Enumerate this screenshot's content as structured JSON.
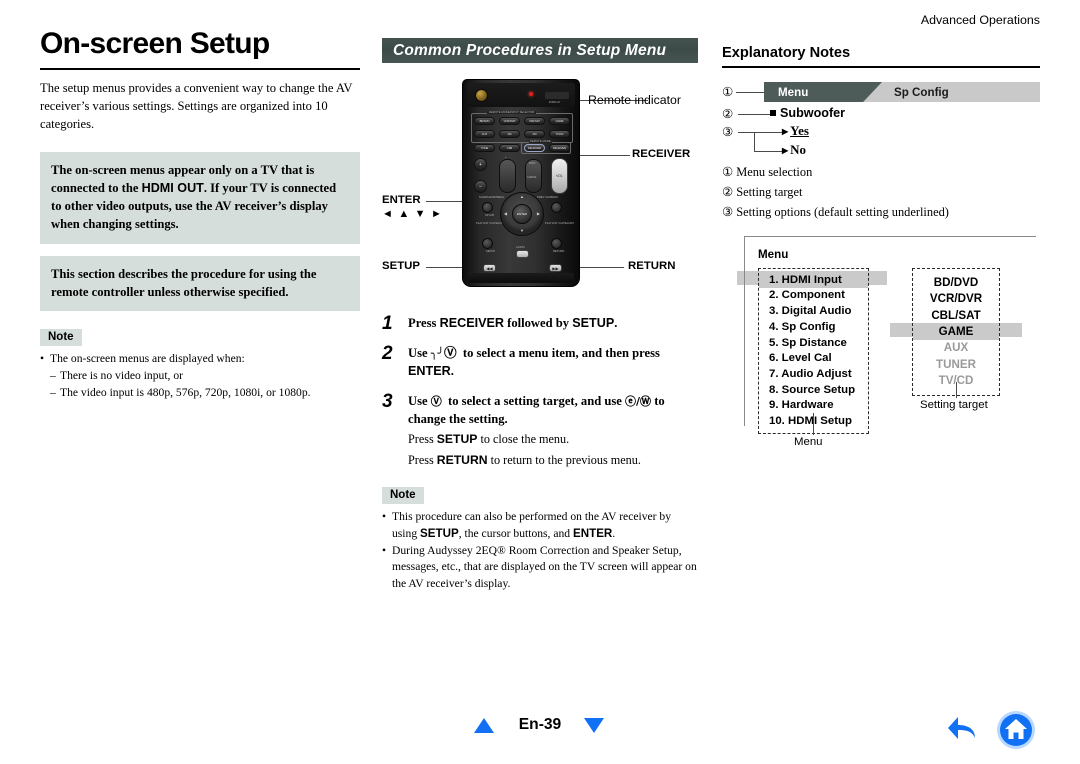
{
  "running_head": "Advanced Operations",
  "left": {
    "title": "On-screen Setup",
    "intro": "The setup menus provides a convenient way to change the AV receiver’s various settings. Settings are organized into 10 categories.",
    "callout_box_1": {
      "text_a": "The on-screen menus appear only on a TV that is connected to the ",
      "emph": "HDMI OUT",
      "text_b": ". If your TV is connected to other video outputs, use the AV receiver’s display when changing settings."
    },
    "callout_box_2": "This section describes the procedure for using the remote controller unless otherwise specified.",
    "note_label": "Note",
    "notes": [
      "The on-screen menus are displayed when:",
      "There is no video input, or",
      "The video input is 480p, 576p, 720p, 1080i, or 1080p."
    ]
  },
  "mid": {
    "section_title": "Common Procedures in Setup Menu",
    "remote": {
      "label_remote_indicator": "Remote indicator",
      "label_receiver": "RECEIVER",
      "label_enter": "ENTER",
      "label_arrows": "◄ ▲ ▼ ►",
      "label_setup": "SETUP",
      "label_return": "RETURN",
      "btn_display": "DISPLAY",
      "group_title": "REMOTE MODE/INPUT SELECTOR",
      "remote_mode_title": "REMOTE MODE",
      "selector_buttons": [
        "BD/DVD",
        "VCR/DVR",
        "CBL/SAT",
        "GAME",
        "AUX",
        "AM",
        "FM",
        "TV/CD",
        "TONE",
        "USB",
        "RECEIVER",
        "RECEIVER"
      ],
      "ch_label": "CH",
      "disc_label": "DISC",
      "album_label": "ALBUM",
      "vol_label": "VOL",
      "enter_label": "ENTER",
      "audio_label": "AUDIO",
      "setup_label": "SETUP",
      "return_label": "RETURN",
      "sp_ab_label": "SP A/B",
      "slideshow_label": "SLIDESHOW/MENU",
      "prev_ch_label": "PREV CH/MENU",
      "playlist_label": "PLAYLIST /CATEGORY",
      "free_ch_label": "FREE CH/MENU"
    },
    "steps": [
      {
        "num": "1",
        "parts": [
          {
            "t": "Press ",
            "s": false
          },
          {
            "t": "RECEIVER",
            "s": true
          },
          {
            "t": " followed by ",
            "s": false
          },
          {
            "t": "SETUP",
            "s": true
          },
          {
            "t": ".",
            "s": false
          }
        ]
      },
      {
        "num": "2",
        "parts": [
          {
            "t": "Use ",
            "s": false
          },
          {
            "t": "⑮",
            "s": false,
            "c": true
          },
          {
            "t": "  to select a menu item, and then press ",
            "s": false
          },
          {
            "t": "ENTER",
            "s": true
          },
          {
            "t": ".",
            "s": false
          }
        ]
      },
      {
        "num": "3",
        "parts": [
          {
            "t": "Use ",
            "s": false
          },
          {
            "t": "⑮",
            "s": false,
            "c": true
          },
          {
            "t": "  to select a setting target, and use ",
            "s": false
          },
          {
            "t": "⑤/⑯",
            "s": false,
            "c": true
          },
          {
            "t": " to change the setting.",
            "s": false
          }
        ],
        "subs": [
          [
            {
              "t": "Press ",
              "s": false
            },
            {
              "t": "SETUP",
              "s": true
            },
            {
              "t": " to close the menu.",
              "s": false
            }
          ],
          [
            {
              "t": "Press ",
              "s": false
            },
            {
              "t": "RETURN",
              "s": true
            },
            {
              "t": " to return to the previous menu.",
              "s": false
            }
          ]
        ]
      }
    ],
    "note_label": "Note",
    "notes": [
      [
        {
          "t": "This procedure can also be performed on the AV receiver by using ",
          "s": false
        },
        {
          "t": "SETUP",
          "s": true
        },
        {
          "t": ", the cursor buttons, and ",
          "s": false
        },
        {
          "t": "ENTER",
          "s": true
        },
        {
          "t": ".",
          "s": false
        }
      ],
      [
        {
          "t": "During Audyssey 2EQ® Room Correction and Speaker Setup, messages, etc., that are displayed on the TV screen will appear on the AV receiver’s display.",
          "s": false
        }
      ]
    ]
  },
  "right": {
    "title": "Explanatory Notes",
    "tab_active": "Menu",
    "tab_second": "Sp Config",
    "marker_1": "①",
    "marker_2": "②",
    "marker_3": "③",
    "tree_target": "Subwoofer",
    "tree_option_yes": "Yes",
    "tree_option_no": "No",
    "legend": [
      {
        "num": "①",
        "text": "Menu selection"
      },
      {
        "num": "②",
        "text": "Setting target"
      },
      {
        "num": "③",
        "text": "Setting options (default setting underlined)"
      }
    ],
    "osd": {
      "caption": "Menu",
      "menu_items": [
        "1. HDMI Input",
        "2. Component",
        "3. Digital Audio",
        "4. Sp Config",
        "5. Sp Distance",
        "6. Level Cal",
        "7. Audio Adjust",
        "8. Source Setup",
        "9. Hardware",
        "10. HDMI Setup"
      ],
      "menu_highlight_index": 0,
      "targets": [
        {
          "label": "BD/DVD",
          "state": "normal"
        },
        {
          "label": "VCR/DVR",
          "state": "normal"
        },
        {
          "label": "CBL/SAT",
          "state": "normal"
        },
        {
          "label": "GAME",
          "state": "highlight"
        },
        {
          "label": "AUX",
          "state": "dim"
        },
        {
          "label": "TUNER",
          "state": "dim"
        },
        {
          "label": "TV/CD",
          "state": "dim"
        }
      ],
      "note_menu": "Menu",
      "note_target": "Setting target"
    }
  },
  "footer": {
    "page": "En-39",
    "nav_up": "up-triangle",
    "nav_down": "down-triangle",
    "back_icon": "back-arrow-icon",
    "home_icon": "home-icon",
    "accent": "#1170f4"
  }
}
